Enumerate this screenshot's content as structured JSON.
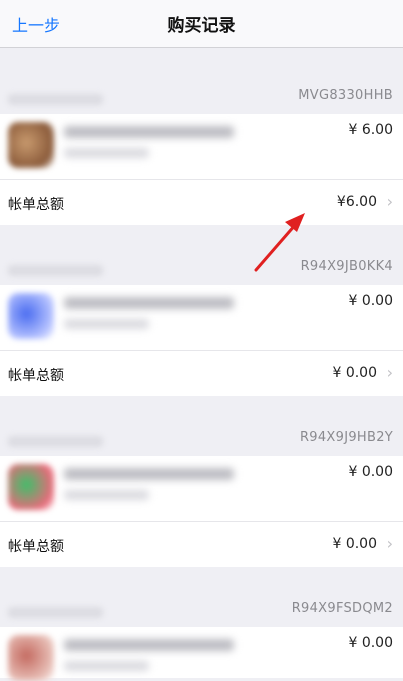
{
  "nav": {
    "back_label": "上一步",
    "title": "购买记录"
  },
  "accent_color": "#1677ff",
  "annotation_color": "#e02020",
  "purchases": [
    {
      "order_id": "MVG8330HHB",
      "item_price": "¥ 6.00",
      "total_label": "帐单总额",
      "total_amount": "¥6.00",
      "thumb_colors": [
        "#c89a6e",
        "#8a5a3a"
      ]
    },
    {
      "order_id": "R94X9JB0KK4",
      "item_price": "¥ 0.00",
      "total_label": "帐单总额",
      "total_amount": "¥ 0.00",
      "thumb_colors": [
        "#4a6cf0",
        "#b8c4ff"
      ]
    },
    {
      "order_id": "R94X9J9HB2Y",
      "item_price": "¥ 0.00",
      "total_label": "帐单总额",
      "total_amount": "¥ 0.00",
      "thumb_colors": [
        "#3fbf6a",
        "#e86a7a"
      ]
    },
    {
      "order_id": "R94X9FSDQM2",
      "item_price": "¥ 0.00",
      "thumb_colors": [
        "#c46a60",
        "#e8c0b8"
      ]
    }
  ]
}
